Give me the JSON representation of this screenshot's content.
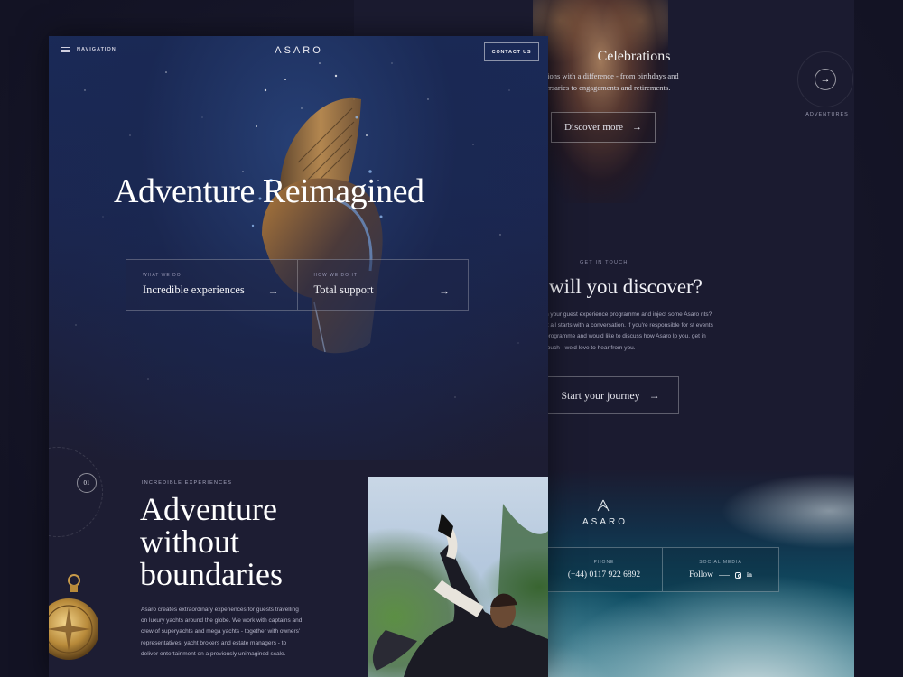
{
  "front": {
    "nav_label": "NAVIGATION",
    "brand": "ASARO",
    "contact_label": "CONTACT US",
    "hero_title": "Adventure Reimagined",
    "features": [
      {
        "caption": "WHAT WE DO",
        "title": "Incredible experiences",
        "arrow": "→"
      },
      {
        "caption": "HOW WE DO IT",
        "title": "Total support",
        "arrow": "→"
      }
    ],
    "section": {
      "number": "01",
      "caption": "INCREDIBLE EXPERIENCES",
      "title_lines": [
        "Adventure",
        "without",
        "boundaries"
      ],
      "text": "Asaro creates extraordinary experiences for guests travelling on luxury yachts around the globe. We work with captains and crew of superyachts and mega yachts - together with owners' representatives, yacht brokers and estate managers - to deliver entertainment on a previously unimagined scale."
    }
  },
  "back": {
    "celebrations_title": "Celebrations",
    "celebrations_text": "ations with a difference - from birthdays and versaries to engagements and retirements.",
    "discover_label": "Discover more",
    "discover_arrow": "→",
    "adventures_arrow": "→",
    "adventures_label": "ADVENTURES",
    "get_in_touch": "GET IN TOUCH",
    "discover_question": "will you discover?",
    "touch_text": "n your guest experience programme and inject some Asaro nts? It all starts with a conversation. If you're responsible for st events programme and would like to discuss how Asaro lp you, get in touch - we'd love to hear from you.",
    "journey_label": "Start your journey",
    "journey_arrow": "→",
    "footer": {
      "brand": "ASARO",
      "phone_caption": "PHONE",
      "phone_value": "(+44) 0117 922 6892",
      "social_caption": "SOCIAL MEDIA",
      "social_value": "Follow",
      "linkedin_glyph": "in"
    }
  }
}
